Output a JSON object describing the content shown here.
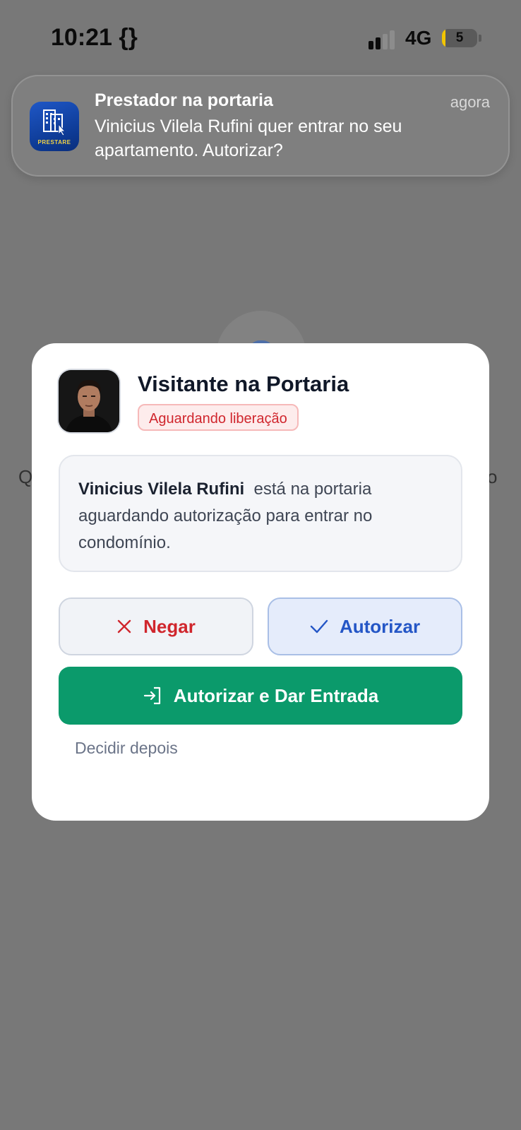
{
  "status_bar": {
    "time": "10:21 {}",
    "network": "4G",
    "battery_level": "5"
  },
  "background": {
    "left_letter": "Q",
    "right_letter": "o"
  },
  "notification": {
    "app_name": "PRESTARE",
    "title": "Prestador na portaria",
    "time": "agora",
    "body": "Vinicius Vilela Rufini  quer entrar no seu apartamento. Autorizar?"
  },
  "modal": {
    "title": "Visitante na Portaria",
    "badge": "Aguardando liberação",
    "visitor_name": "Vinicius Vilela Rufini",
    "message_rest": "está na portaria aguardando autorização para entrar no condomínio.",
    "deny_label": "Negar",
    "authorize_label": "Autorizar",
    "authorize_enter_label": "Autorizar e Dar Entrada",
    "decide_later_label": "Decidir depois"
  },
  "colors": {
    "overlay": "#787878",
    "danger": "#d0262d",
    "primary": "#2456c6",
    "success": "#0b9a6b"
  },
  "icons": {
    "deny": "close-icon",
    "authorize": "check-icon",
    "enter": "login-icon"
  }
}
